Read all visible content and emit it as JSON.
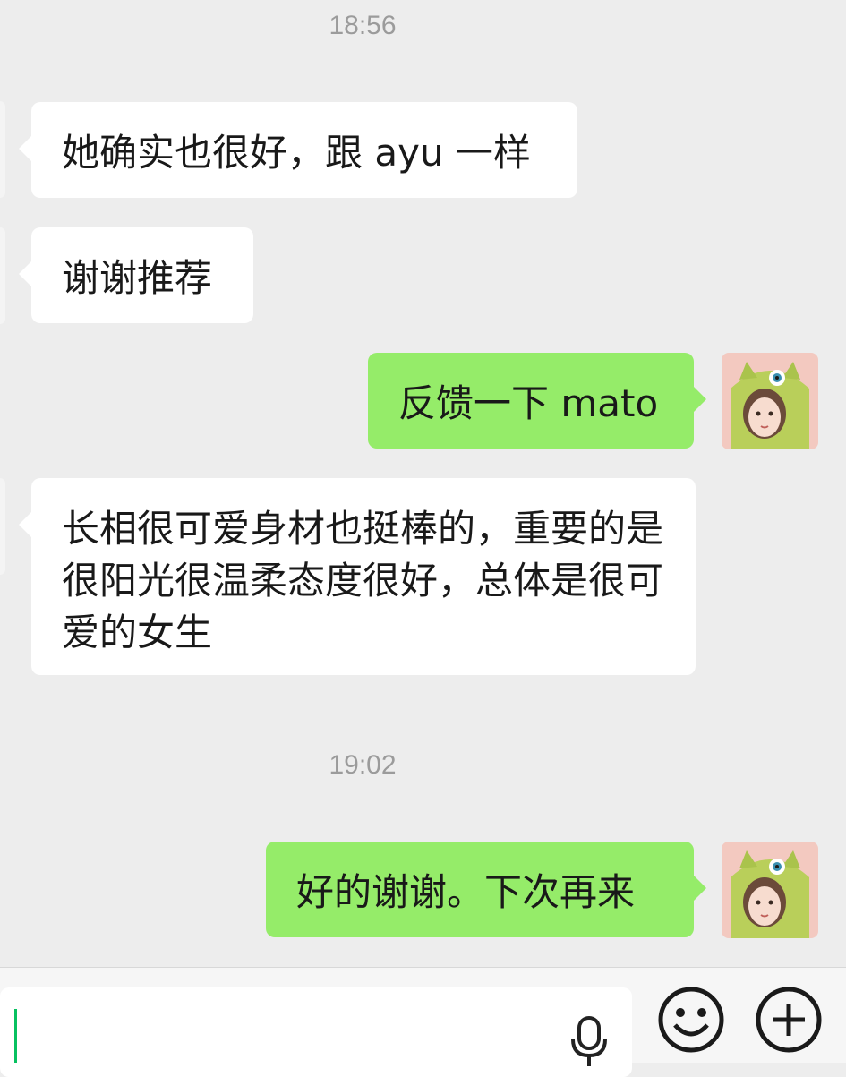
{
  "chat": {
    "timestamps": [
      "18:56",
      "19:02"
    ],
    "messages": [
      {
        "side": "received",
        "text": "她确实也很好，跟 ayu 一样"
      },
      {
        "side": "received",
        "text": "谢谢推荐"
      },
      {
        "side": "sent",
        "text": "反馈一下 mato"
      },
      {
        "side": "received",
        "text": "长相很可爱身材也挺棒的，重要的是很阳光很温柔态度很好，总体是很可爱的女生"
      },
      {
        "side": "sent",
        "text": "好的谢谢。下次再来"
      }
    ]
  },
  "input_bar": {
    "text_value": "",
    "icons": [
      "microphone-icon",
      "emoji-icon",
      "plus-icon"
    ]
  },
  "colors": {
    "background": "#ededed",
    "sent_bubble": "#95ec69",
    "received_bubble": "#ffffff",
    "caret": "#07c160"
  }
}
